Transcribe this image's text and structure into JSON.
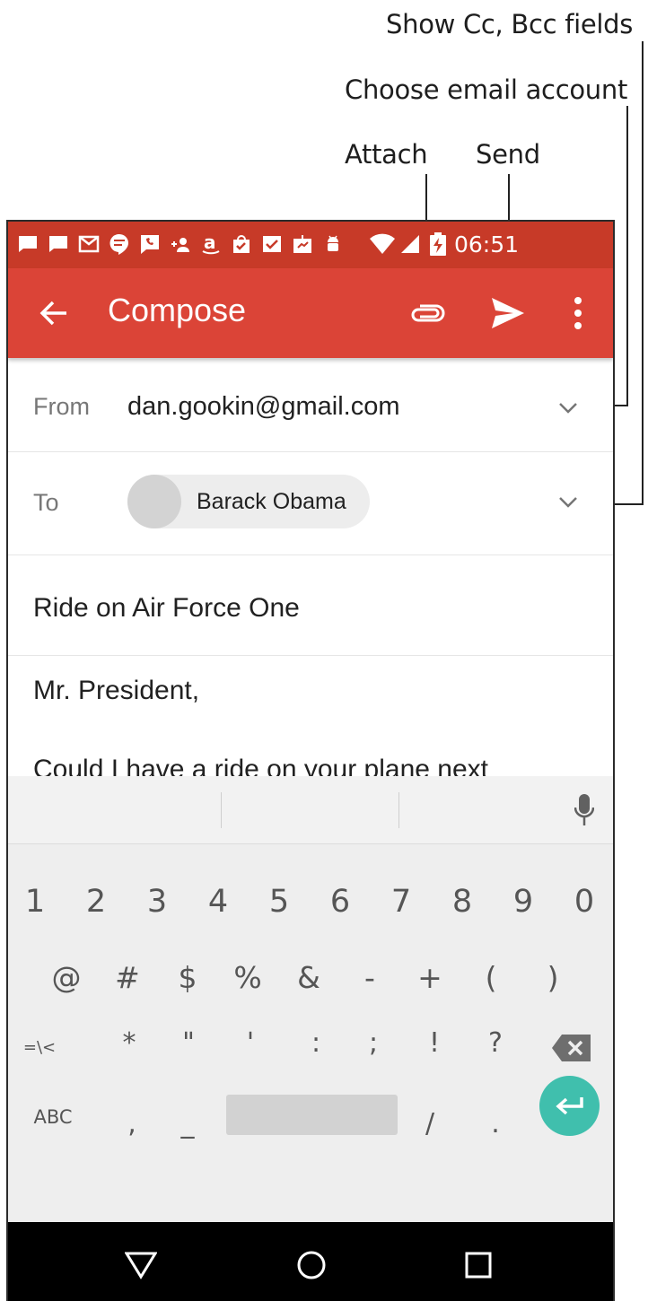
{
  "callouts": {
    "cc_bcc": "Show Cc, Bcc fields",
    "account": "Choose email account",
    "attach": "Attach",
    "send": "Send"
  },
  "status_bar": {
    "time": "06:51",
    "icons": [
      "message-icon",
      "message-icon",
      "gmail-icon",
      "hangouts-icon",
      "voice-icon",
      "contact-add-icon",
      "amazon-icon",
      "bag-check-icon",
      "mail-check-icon",
      "cloud-icon",
      "android-icon",
      "wifi-icon",
      "signal-icon",
      "battery-charging-icon"
    ]
  },
  "app_bar": {
    "title": "Compose",
    "back_icon": "back-arrow-icon",
    "attach_icon": "paperclip-icon",
    "send_icon": "send-icon",
    "overflow_icon": "more-vert-icon"
  },
  "from": {
    "label": "From",
    "value": "dan.gookin@gmail.com"
  },
  "to": {
    "label": "To",
    "recipient": "Barack Obama"
  },
  "subject": "Ride on Air Force One",
  "body": {
    "line1": "Mr. President,",
    "line2": "Could I have a ride on your plane next"
  },
  "keyboard": {
    "mic_icon": "microphone-icon",
    "row1": [
      "1",
      "2",
      "3",
      "4",
      "5",
      "6",
      "7",
      "8",
      "9",
      "0"
    ],
    "row2": [
      "@",
      "#",
      "$",
      "%",
      "&",
      "-",
      "+",
      "(",
      ")"
    ],
    "row3": [
      "=\\<",
      "*",
      "\"",
      "'",
      ":",
      ";",
      "!",
      "?"
    ],
    "row4": [
      "ABC",
      ",",
      "_",
      "/",
      "."
    ],
    "backspace_icon": "backspace-icon",
    "enter_icon": "enter-icon"
  },
  "nav_bar": {
    "icons": [
      "back-triangle-icon",
      "home-circle-icon",
      "recents-square-icon"
    ]
  },
  "colors": {
    "status_bar": "#c73a28",
    "app_bar": "#db4437",
    "enter_key": "#40bfad"
  }
}
